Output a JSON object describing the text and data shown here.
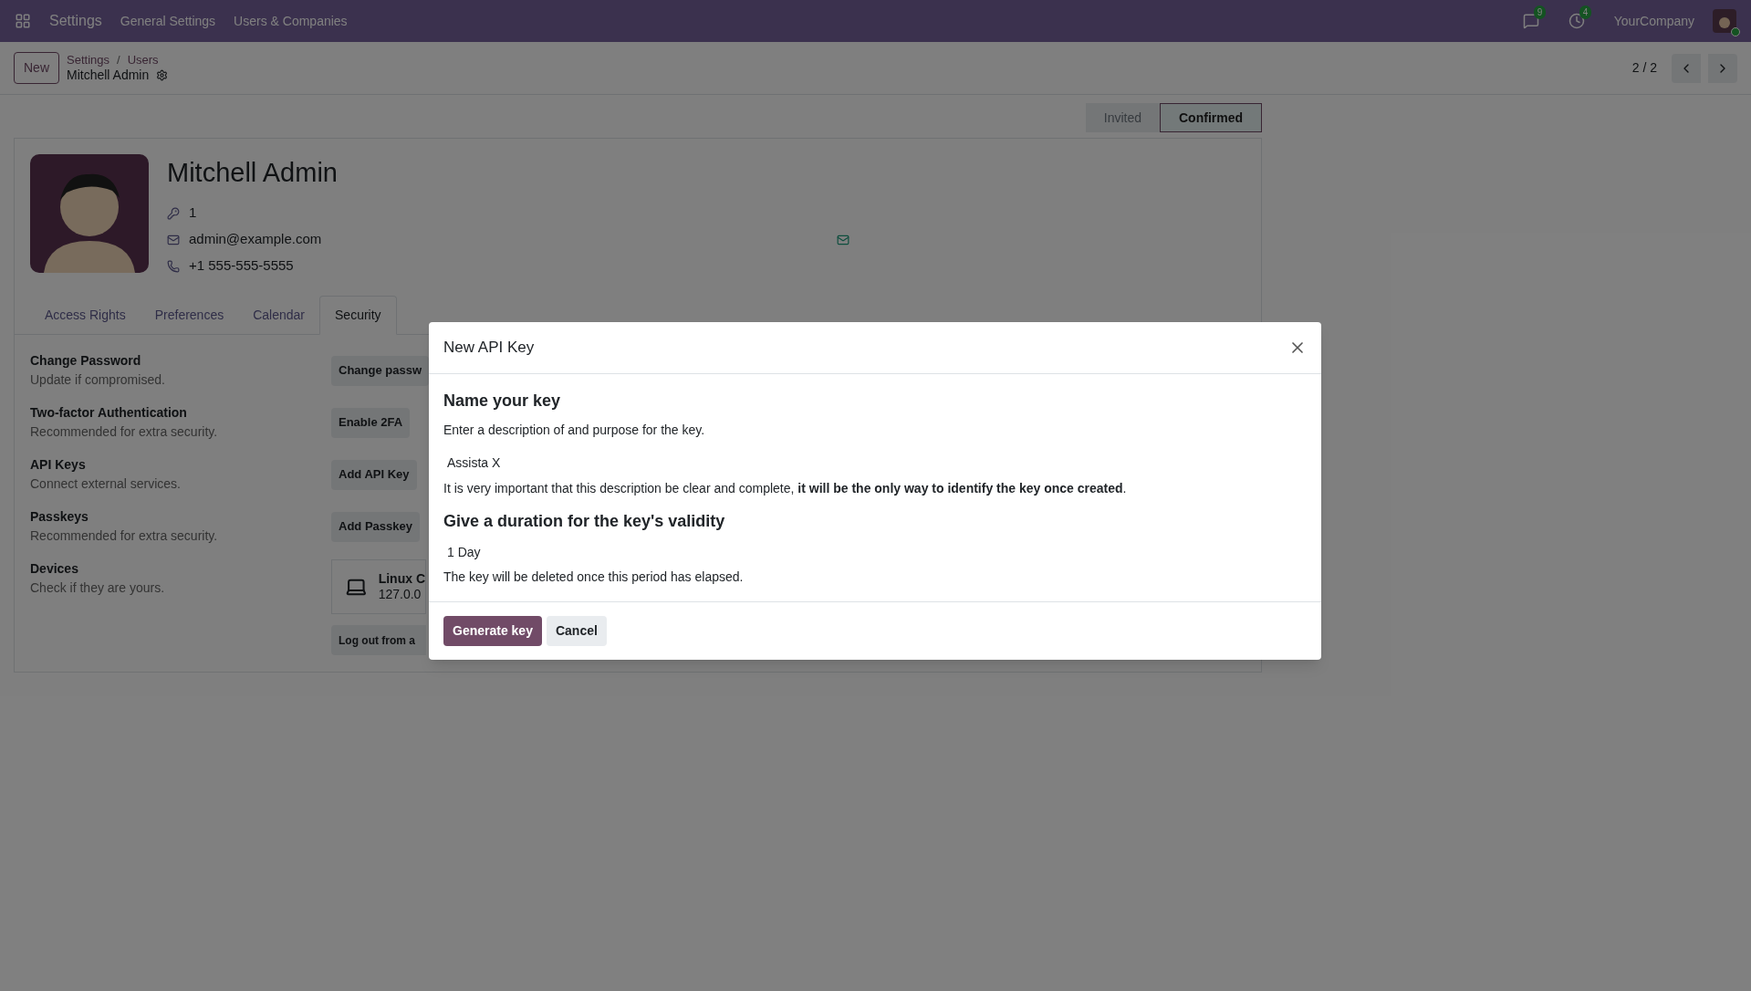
{
  "navbar": {
    "app_name": "Settings",
    "menu": [
      "General Settings",
      "Users & Companies"
    ],
    "messages_count": "9",
    "activities_count": "4",
    "company": "YourCompany"
  },
  "control_panel": {
    "new_button": "New",
    "breadcrumb": [
      "Settings",
      "Users"
    ],
    "breadcrumb_separator": "/",
    "record": "Mitchell Admin",
    "pager": "2 / 2"
  },
  "status_bar": [
    {
      "label": "Invited",
      "selected": false
    },
    {
      "label": "Confirmed",
      "selected": true
    }
  ],
  "profile": {
    "name": "Mitchell Admin",
    "fields": [
      {
        "kind": "login",
        "value": "1"
      },
      {
        "kind": "email",
        "value": "admin@example.com"
      },
      {
        "kind": "phone",
        "value": "+1 555-555-5555"
      }
    ]
  },
  "tabs": [
    {
      "label": "Access Rights",
      "selected": false
    },
    {
      "label": "Preferences",
      "selected": false
    },
    {
      "label": "Calendar",
      "selected": false
    },
    {
      "label": "Security",
      "selected": true
    }
  ],
  "security": [
    {
      "kind": "button",
      "title": "Change Password",
      "description": "Update if compromised.",
      "button": "Change passw"
    },
    {
      "kind": "button",
      "title": "Two-factor Authentication",
      "description": "Recommended for extra security.",
      "button": "Enable 2FA"
    },
    {
      "kind": "button",
      "title": "API Keys",
      "description": "Connect external services.",
      "button": "Add API Key"
    },
    {
      "kind": "button",
      "title": "Passkeys",
      "description": "Recommended for extra security.",
      "button": "Add Passkey"
    },
    {
      "kind": "devices",
      "title": "Devices",
      "description": "Check if they are yours.",
      "device": "Linux C",
      "address": "127.0.0",
      "button": "Log out from a"
    }
  ],
  "modal": {
    "title": "New API Key",
    "name_heading": "Name your key",
    "name_help": "Enter a description of and purpose for the key.",
    "name_value": "Assista X",
    "name_note": "It is very important that this description be clear and complete, **it will be the only way to identify the key once created**.",
    "duration_heading": "Give a duration for the key's validity",
    "duration_value": "1 Day",
    "duration_note": "The key will be deleted once this period has elapsed.",
    "primary_button": "Generate key",
    "secondary_button": "Cancel"
  }
}
